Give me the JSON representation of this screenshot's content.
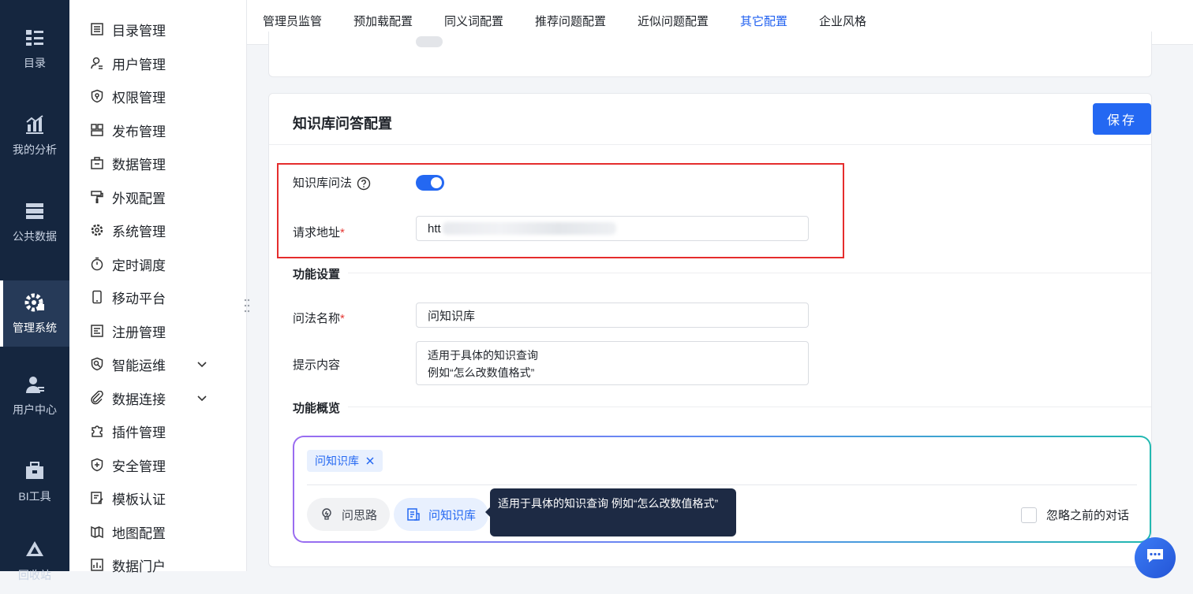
{
  "rail": {
    "items": [
      {
        "label": "目录",
        "icon": "catalog-icon"
      },
      {
        "label": "我的分析",
        "icon": "analysis-icon"
      },
      {
        "label": "公共数据",
        "icon": "database-icon"
      },
      {
        "label": "管理系统",
        "icon": "gear-icon",
        "active": true
      },
      {
        "label": "用户中心",
        "icon": "user-icon"
      },
      {
        "label": "BI工具",
        "icon": "toolbox-icon"
      },
      {
        "label": "回收站",
        "icon": "recycle-icon"
      }
    ]
  },
  "menu": {
    "items": [
      {
        "label": "目录管理",
        "icon": "list-icon"
      },
      {
        "label": "用户管理",
        "icon": "user-manage-icon"
      },
      {
        "label": "权限管理",
        "icon": "shield-icon"
      },
      {
        "label": "发布管理",
        "icon": "publish-icon"
      },
      {
        "label": "数据管理",
        "icon": "data-icon"
      },
      {
        "label": "外观配置",
        "icon": "brush-icon"
      },
      {
        "label": "系统管理",
        "icon": "settings-icon"
      },
      {
        "label": "定时调度",
        "icon": "timer-icon"
      },
      {
        "label": "移动平台",
        "icon": "mobile-icon"
      },
      {
        "label": "注册管理",
        "icon": "register-icon"
      },
      {
        "label": "智能运维",
        "icon": "ops-icon",
        "expandable": true
      },
      {
        "label": "数据连接",
        "icon": "link-icon",
        "expandable": true
      },
      {
        "label": "插件管理",
        "icon": "plugin-icon"
      },
      {
        "label": "安全管理",
        "icon": "security-icon"
      },
      {
        "label": "模板认证",
        "icon": "template-icon"
      },
      {
        "label": "地图配置",
        "icon": "map-icon"
      },
      {
        "label": "数据门户",
        "icon": "portal-icon"
      }
    ]
  },
  "tabs": [
    {
      "label": "管理员监管"
    },
    {
      "label": "预加载配置"
    },
    {
      "label": "同义词配置"
    },
    {
      "label": "推荐问题配置"
    },
    {
      "label": "近似问题配置"
    },
    {
      "label": "其它配置",
      "active": true
    },
    {
      "label": "企业风格"
    }
  ],
  "card": {
    "title": "知识库问答配置",
    "save_label": "保存",
    "kb_question_label": "知识库问法",
    "kb_question_enabled": true,
    "request_url_label": "请求地址",
    "request_url_value": "htt",
    "required_mark": "*",
    "function_settings_title": "功能设置",
    "question_name_label": "问法名称",
    "question_name_value": "问知识库",
    "hint_label": "提示内容",
    "hint_line1": "适用于具体的知识查询",
    "hint_line2": "例如“怎么改数值格式”",
    "overview_title": "功能概览",
    "chip_label": "问知识库",
    "pill_idea": "问思路",
    "pill_kb": "问知识库",
    "ignore_label": "忽略之前的对话",
    "tooltip_text": "适用于具体的知识查询 例如“怎么改数值格式”"
  },
  "colors": {
    "primary": "#2468f2",
    "rail_bg": "#15263f",
    "highlight": "#e52d2d",
    "tooltip_bg": "#1d2a44"
  }
}
